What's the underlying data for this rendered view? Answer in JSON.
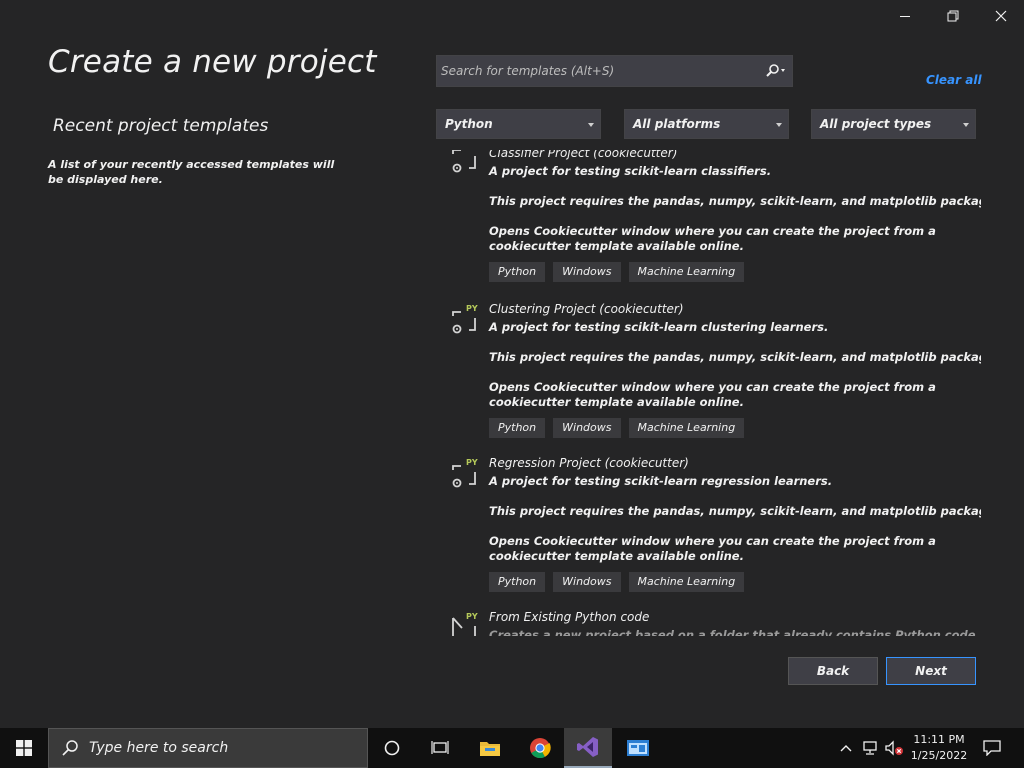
{
  "window": {
    "controls": {
      "minimize": "–",
      "restore": "❐",
      "close": "✕"
    }
  },
  "page": {
    "title": "Create a new project",
    "recent_title": "Recent project templates",
    "recent_desc": "A list of your recently accessed templates will be displayed here."
  },
  "search": {
    "placeholder": "Search for templates (Alt+S)",
    "value": ""
  },
  "clear_all": "Clear all",
  "filters": {
    "language": "Python",
    "platform": "All platforms",
    "project_type": "All project types"
  },
  "templates": [
    {
      "title": "Classifier Project (cookiecutter)",
      "summary": "A project for testing scikit-learn classifiers.",
      "requires": "This project requires the pandas, numpy, scikit-learn, and matplotlib packages.",
      "opens_line1": "Opens Cookiecutter window where you can create the project from a",
      "opens_line2": "cookiecutter template available online.",
      "tags": [
        "Python",
        "Windows",
        "Machine Learning"
      ]
    },
    {
      "title": "Clustering Project (cookiecutter)",
      "summary": "A project for testing scikit-learn clustering learners.",
      "requires": "This project requires the pandas, numpy, scikit-learn, and matplotlib packages.",
      "opens_line1": "Opens Cookiecutter window where you can create the project from a",
      "opens_line2": "cookiecutter template available online.",
      "tags": [
        "Python",
        "Windows",
        "Machine Learning"
      ]
    },
    {
      "title": "Regression Project (cookiecutter)",
      "summary": "A project for testing scikit-learn regression learners.",
      "requires": "This project requires the pandas, numpy, scikit-learn, and matplotlib packages.",
      "opens_line1": "Opens Cookiecutter window where you can create the project from a",
      "opens_line2": "cookiecutter template available online.",
      "tags": [
        "Python",
        "Windows",
        "Machine Learning"
      ]
    },
    {
      "title": "From Existing Python code",
      "summary": "Creates a new project based on a folder that already contains Python code."
    }
  ],
  "icon_badge": "PY",
  "buttons": {
    "back": "Back",
    "next": "Next"
  },
  "taskbar": {
    "search_placeholder": "Type here to search",
    "time": "11:11 PM",
    "date": "1/25/2022"
  }
}
